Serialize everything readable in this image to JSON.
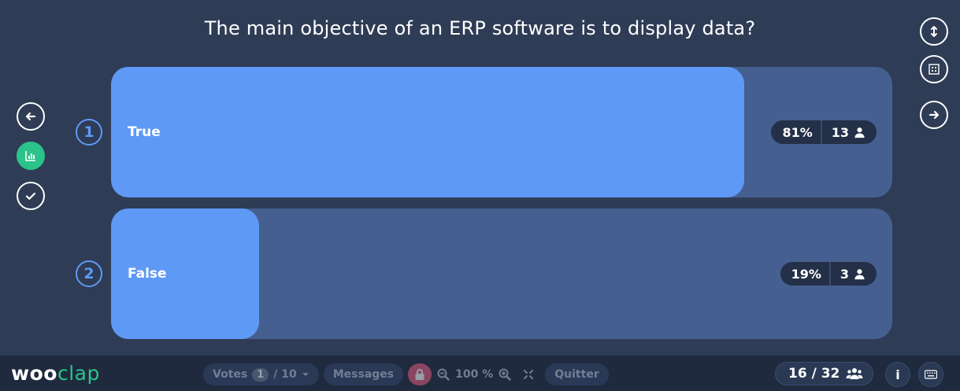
{
  "question": "The main objective of an ERP software is to display data?",
  "answers": [
    {
      "number": "1",
      "label": "True",
      "percent_text": "81%",
      "count": "13",
      "fill": 0.81
    },
    {
      "number": "2",
      "label": "False",
      "percent_text": "19%",
      "count": "3",
      "fill": 0.19
    }
  ],
  "left_controls": [
    "previous-icon",
    "chart-icon",
    "check-icon"
  ],
  "right_controls": [
    "toggle-height-icon",
    "grid-icon",
    "next-icon"
  ],
  "logo": {
    "part1": "woo",
    "part2": "clap"
  },
  "toolbar": {
    "votes_label": "Votes",
    "votes_current": "1",
    "votes_total": "/ 10",
    "messages_label": "Messages",
    "zoom_value": "100 %",
    "quit_label": "Quitter"
  },
  "participants": "16 / 32",
  "info_label": "i",
  "colors": {
    "background": "#2f3c55",
    "bar_track": "#455f91",
    "bar_fill": "#5f99f6",
    "accent_green": "#2bc38a",
    "lock_red": "#e25d7e"
  }
}
